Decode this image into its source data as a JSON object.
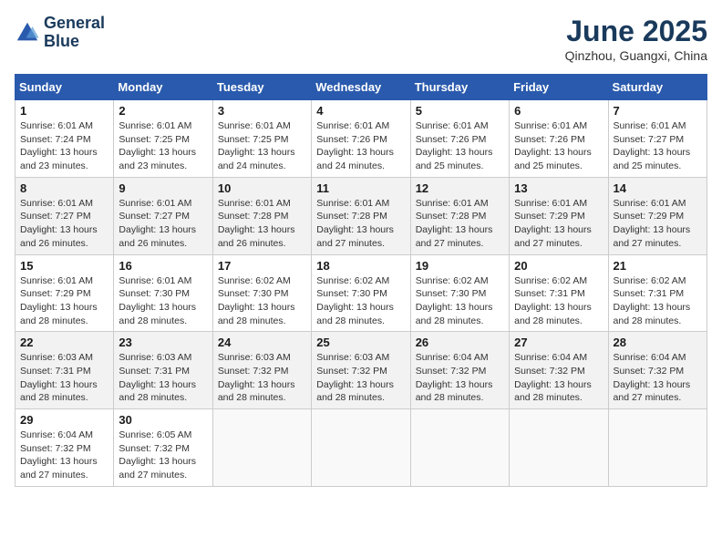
{
  "header": {
    "logo_line1": "General",
    "logo_line2": "Blue",
    "month_year": "June 2025",
    "location": "Qinzhou, Guangxi, China"
  },
  "weekdays": [
    "Sunday",
    "Monday",
    "Tuesday",
    "Wednesday",
    "Thursday",
    "Friday",
    "Saturday"
  ],
  "weeks": [
    [
      {
        "day": "1",
        "sunrise": "6:01 AM",
        "sunset": "7:24 PM",
        "daylight": "13 hours and 23 minutes."
      },
      {
        "day": "2",
        "sunrise": "6:01 AM",
        "sunset": "7:25 PM",
        "daylight": "13 hours and 23 minutes."
      },
      {
        "day": "3",
        "sunrise": "6:01 AM",
        "sunset": "7:25 PM",
        "daylight": "13 hours and 24 minutes."
      },
      {
        "day": "4",
        "sunrise": "6:01 AM",
        "sunset": "7:26 PM",
        "daylight": "13 hours and 24 minutes."
      },
      {
        "day": "5",
        "sunrise": "6:01 AM",
        "sunset": "7:26 PM",
        "daylight": "13 hours and 25 minutes."
      },
      {
        "day": "6",
        "sunrise": "6:01 AM",
        "sunset": "7:26 PM",
        "daylight": "13 hours and 25 minutes."
      },
      {
        "day": "7",
        "sunrise": "6:01 AM",
        "sunset": "7:27 PM",
        "daylight": "13 hours and 25 minutes."
      }
    ],
    [
      {
        "day": "8",
        "sunrise": "6:01 AM",
        "sunset": "7:27 PM",
        "daylight": "13 hours and 26 minutes."
      },
      {
        "day": "9",
        "sunrise": "6:01 AM",
        "sunset": "7:27 PM",
        "daylight": "13 hours and 26 minutes."
      },
      {
        "day": "10",
        "sunrise": "6:01 AM",
        "sunset": "7:28 PM",
        "daylight": "13 hours and 26 minutes."
      },
      {
        "day": "11",
        "sunrise": "6:01 AM",
        "sunset": "7:28 PM",
        "daylight": "13 hours and 27 minutes."
      },
      {
        "day": "12",
        "sunrise": "6:01 AM",
        "sunset": "7:28 PM",
        "daylight": "13 hours and 27 minutes."
      },
      {
        "day": "13",
        "sunrise": "6:01 AM",
        "sunset": "7:29 PM",
        "daylight": "13 hours and 27 minutes."
      },
      {
        "day": "14",
        "sunrise": "6:01 AM",
        "sunset": "7:29 PM",
        "daylight": "13 hours and 27 minutes."
      }
    ],
    [
      {
        "day": "15",
        "sunrise": "6:01 AM",
        "sunset": "7:29 PM",
        "daylight": "13 hours and 28 minutes."
      },
      {
        "day": "16",
        "sunrise": "6:01 AM",
        "sunset": "7:30 PM",
        "daylight": "13 hours and 28 minutes."
      },
      {
        "day": "17",
        "sunrise": "6:02 AM",
        "sunset": "7:30 PM",
        "daylight": "13 hours and 28 minutes."
      },
      {
        "day": "18",
        "sunrise": "6:02 AM",
        "sunset": "7:30 PM",
        "daylight": "13 hours and 28 minutes."
      },
      {
        "day": "19",
        "sunrise": "6:02 AM",
        "sunset": "7:30 PM",
        "daylight": "13 hours and 28 minutes."
      },
      {
        "day": "20",
        "sunrise": "6:02 AM",
        "sunset": "7:31 PM",
        "daylight": "13 hours and 28 minutes."
      },
      {
        "day": "21",
        "sunrise": "6:02 AM",
        "sunset": "7:31 PM",
        "daylight": "13 hours and 28 minutes."
      }
    ],
    [
      {
        "day": "22",
        "sunrise": "6:03 AM",
        "sunset": "7:31 PM",
        "daylight": "13 hours and 28 minutes."
      },
      {
        "day": "23",
        "sunrise": "6:03 AM",
        "sunset": "7:31 PM",
        "daylight": "13 hours and 28 minutes."
      },
      {
        "day": "24",
        "sunrise": "6:03 AM",
        "sunset": "7:32 PM",
        "daylight": "13 hours and 28 minutes."
      },
      {
        "day": "25",
        "sunrise": "6:03 AM",
        "sunset": "7:32 PM",
        "daylight": "13 hours and 28 minutes."
      },
      {
        "day": "26",
        "sunrise": "6:04 AM",
        "sunset": "7:32 PM",
        "daylight": "13 hours and 28 minutes."
      },
      {
        "day": "27",
        "sunrise": "6:04 AM",
        "sunset": "7:32 PM",
        "daylight": "13 hours and 28 minutes."
      },
      {
        "day": "28",
        "sunrise": "6:04 AM",
        "sunset": "7:32 PM",
        "daylight": "13 hours and 27 minutes."
      }
    ],
    [
      {
        "day": "29",
        "sunrise": "6:04 AM",
        "sunset": "7:32 PM",
        "daylight": "13 hours and 27 minutes."
      },
      {
        "day": "30",
        "sunrise": "6:05 AM",
        "sunset": "7:32 PM",
        "daylight": "13 hours and 27 minutes."
      },
      null,
      null,
      null,
      null,
      null
    ]
  ]
}
